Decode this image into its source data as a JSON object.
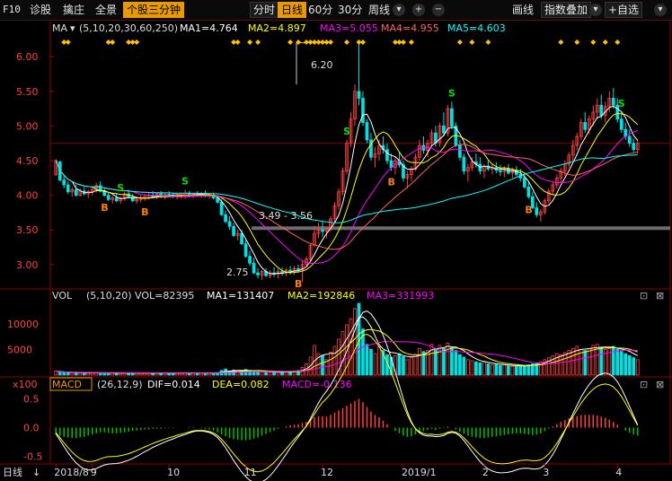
{
  "toolbar": {
    "f10": "F10",
    "diagnose": "诊股",
    "pullup": "擒庄",
    "overview": "全景",
    "period_3min": "个股三分钟",
    "intraday": "分时",
    "daily": "日线",
    "min60": "60分",
    "min30": "30分",
    "weekly": "周线",
    "draw": "画线",
    "overlay": "指数叠加",
    "add": "+",
    "watchlist": "+自选",
    "plus_icon": "+",
    "minus_icon": "−",
    "dropdown_icon": "▾"
  },
  "main_legend": {
    "name": "MA",
    "params": "(5,10,20,30,60,250)",
    "ma1": "MA1=4.764",
    "ma2": "MA2=4.897",
    "ma3": "MA3=5.055",
    "ma4": "MA4=4.955",
    "ma5": "MA5=4.603"
  },
  "annotations": {
    "high": "6.20",
    "low": "2.75",
    "range": "3.49 - 3.56"
  },
  "vol_legend": {
    "name": "VOL",
    "params": "(5,10,20)",
    "vol": "VOL=82395",
    "ma1": "MA1=131407",
    "ma2": "MA2=192846",
    "ma3": "MA3=331993",
    "unit": "x100"
  },
  "macd_legend": {
    "name": "MACD",
    "params": "(26,12,9)",
    "dif": "DIF=0.014",
    "dea": "DEA=0.082",
    "macd": "MACD=-0.136"
  },
  "bottom": {
    "period": "日线"
  },
  "colors": {
    "up": "#ff4040",
    "down": "#00e0e0",
    "ma1": "#ffffff",
    "ma2": "#ffff00",
    "ma3": "#ff00ff",
    "ma4": "#ff6060",
    "ma5": "#00ffff",
    "axis": "#b00000",
    "orange": "#ff8000"
  },
  "chart_data": {
    "type": "candlestick",
    "price_axis": {
      "ticks": [
        6.0,
        5.5,
        5.0,
        4.5,
        4.0,
        3.5,
        3.0
      ],
      "labels": [
        "6.00",
        "5.50",
        "5.00",
        "4.50",
        "4.00",
        "3.50",
        "3.00"
      ],
      "ylim": [
        2.7,
        6.3
      ]
    },
    "volume_axis": {
      "ticks": [
        10000,
        5000
      ],
      "labels": [
        "10000",
        "5000"
      ],
      "ylim": [
        0,
        14000
      ]
    },
    "macd_axis": {
      "ticks": [
        0.5,
        0.0,
        -0.5
      ],
      "labels": [
        "0.5",
        "0.0",
        "-0.5"
      ],
      "ylim": [
        -0.6,
        0.6
      ]
    },
    "x_labels": [
      "2018/8",
      "9",
      "10",
      "11",
      "12",
      "2019/1",
      "2",
      "3",
      "4"
    ],
    "signals": {
      "buy": "B",
      "sell": "S"
    },
    "candles": [
      [
        4.3,
        4.52,
        4.28,
        4.5
      ],
      [
        4.48,
        4.5,
        4.2,
        4.22
      ],
      [
        4.22,
        4.3,
        4.1,
        4.15
      ],
      [
        4.15,
        4.2,
        4.02,
        4.05
      ],
      [
        4.05,
        4.12,
        3.98,
        4.08
      ],
      [
        4.08,
        4.15,
        3.98,
        4.0
      ],
      [
        4.0,
        4.1,
        3.98,
        4.06
      ],
      [
        4.06,
        4.12,
        4.0,
        4.02
      ],
      [
        4.02,
        4.08,
        3.96,
        4.05
      ],
      [
        4.05,
        4.12,
        4.0,
        4.08
      ],
      [
        4.08,
        4.18,
        4.04,
        4.14
      ],
      [
        4.14,
        4.2,
        4.04,
        4.06
      ],
      [
        4.06,
        4.1,
        3.98,
        4.0
      ],
      [
        4.0,
        4.04,
        3.92,
        3.94
      ],
      [
        3.94,
        4.0,
        3.88,
        3.96
      ],
      [
        3.96,
        4.02,
        3.9,
        3.92
      ],
      [
        3.92,
        3.98,
        3.88,
        3.95
      ],
      [
        3.95,
        4.05,
        3.92,
        4.02
      ],
      [
        4.02,
        4.08,
        3.96,
        3.98
      ],
      [
        3.98,
        4.02,
        3.9,
        3.92
      ],
      [
        3.92,
        3.98,
        3.88,
        3.94
      ],
      [
        3.94,
        4.0,
        3.9,
        3.96
      ],
      [
        3.96,
        4.02,
        3.92,
        3.98
      ],
      [
        3.98,
        4.05,
        3.94,
        4.0
      ],
      [
        4.0,
        4.06,
        3.96,
        3.97
      ],
      [
        3.97,
        4.04,
        3.94,
        4.02
      ],
      [
        4.02,
        4.06,
        3.96,
        3.99
      ],
      [
        3.99,
        4.04,
        3.94,
        4.01
      ],
      [
        4.01,
        4.06,
        3.98,
        4.0
      ],
      [
        4.0,
        4.04,
        3.96,
        3.98
      ],
      [
        3.98,
        4.02,
        3.94,
        3.99
      ],
      [
        3.99,
        4.03,
        3.95,
        4.0
      ],
      [
        4.0,
        4.08,
        3.95,
        4.03
      ],
      [
        4.03,
        4.06,
        3.97,
        3.99
      ],
      [
        3.99,
        4.04,
        3.96,
        4.02
      ],
      [
        4.02,
        4.06,
        3.98,
        4.0
      ],
      [
        4.0,
        4.05,
        3.96,
        4.03
      ],
      [
        4.03,
        4.07,
        3.97,
        3.99
      ],
      [
        3.99,
        4.03,
        3.95,
        4.0
      ],
      [
        4.0,
        4.04,
        3.94,
        3.96
      ],
      [
        3.96,
        4.0,
        3.88,
        3.9
      ],
      [
        3.9,
        3.94,
        3.7,
        3.72
      ],
      [
        3.72,
        3.78,
        3.6,
        3.62
      ],
      [
        3.62,
        3.7,
        3.5,
        3.55
      ],
      [
        3.55,
        3.6,
        3.4,
        3.42
      ],
      [
        3.42,
        3.5,
        3.35,
        3.45
      ],
      [
        3.45,
        3.5,
        3.28,
        3.3
      ],
      [
        3.3,
        3.35,
        3.1,
        3.12
      ],
      [
        3.12,
        3.2,
        2.98,
        3.02
      ],
      [
        3.02,
        3.1,
        2.86,
        2.88
      ],
      [
        2.88,
        2.95,
        2.8,
        2.85
      ],
      [
        2.85,
        2.92,
        2.78,
        2.9
      ],
      [
        2.9,
        2.95,
        2.82,
        2.84
      ],
      [
        2.84,
        2.92,
        2.8,
        2.88
      ],
      [
        2.88,
        2.96,
        2.82,
        2.86
      ],
      [
        2.86,
        2.94,
        2.8,
        2.9
      ],
      [
        2.9,
        2.96,
        2.84,
        2.88
      ],
      [
        2.88,
        2.95,
        2.83,
        2.92
      ],
      [
        2.92,
        2.98,
        2.86,
        2.9
      ],
      [
        2.9,
        2.98,
        2.85,
        2.94
      ],
      [
        2.94,
        3.0,
        2.88,
        2.92
      ],
      [
        2.92,
        3.05,
        2.75,
        3.0
      ],
      [
        3.0,
        3.12,
        2.96,
        3.08
      ],
      [
        3.08,
        3.3,
        3.05,
        3.28
      ],
      [
        3.28,
        3.56,
        3.25,
        3.45
      ],
      [
        3.45,
        3.6,
        3.38,
        3.5
      ],
      [
        3.5,
        3.62,
        3.4,
        3.48
      ],
      [
        3.48,
        3.55,
        3.38,
        3.52
      ],
      [
        3.52,
        3.7,
        3.48,
        3.66
      ],
      [
        3.66,
        3.9,
        3.6,
        3.85
      ],
      [
        3.85,
        4.1,
        3.8,
        4.05
      ],
      [
        4.05,
        4.4,
        4.0,
        4.35
      ],
      [
        4.35,
        4.8,
        4.3,
        4.75
      ],
      [
        4.75,
        5.2,
        4.7,
        5.1
      ],
      [
        5.1,
        5.6,
        5.0,
        5.5
      ],
      [
        5.5,
        6.2,
        5.3,
        5.4
      ],
      [
        5.4,
        5.5,
        5.0,
        5.05
      ],
      [
        5.05,
        5.1,
        4.75,
        4.8
      ],
      [
        4.8,
        4.9,
        4.5,
        4.55
      ],
      [
        4.55,
        4.7,
        4.4,
        4.6
      ],
      [
        4.6,
        4.8,
        4.5,
        4.72
      ],
      [
        4.72,
        4.85,
        4.6,
        4.66
      ],
      [
        4.66,
        4.75,
        4.45,
        4.5
      ],
      [
        4.5,
        4.6,
        4.35,
        4.4
      ],
      [
        4.4,
        4.55,
        4.3,
        4.5
      ],
      [
        4.5,
        4.62,
        4.4,
        4.44
      ],
      [
        4.44,
        4.5,
        4.2,
        4.25
      ],
      [
        4.25,
        4.35,
        4.1,
        4.3
      ],
      [
        4.3,
        4.42,
        4.2,
        4.38
      ],
      [
        4.38,
        4.6,
        4.35,
        4.55
      ],
      [
        4.55,
        4.8,
        4.5,
        4.72
      ],
      [
        4.72,
        4.85,
        4.6,
        4.65
      ],
      [
        4.65,
        4.8,
        4.55,
        4.75
      ],
      [
        4.75,
        4.95,
        4.7,
        4.9
      ],
      [
        4.9,
        5.0,
        4.7,
        4.76
      ],
      [
        4.76,
        5.05,
        4.7,
        5.0
      ],
      [
        5.0,
        5.2,
        4.85,
        4.9
      ],
      [
        4.9,
        5.3,
        4.85,
        5.25
      ],
      [
        5.25,
        5.35,
        4.95,
        5.0
      ],
      [
        5.0,
        5.05,
        4.7,
        4.72
      ],
      [
        4.72,
        4.8,
        4.5,
        4.55
      ],
      [
        4.55,
        4.6,
        4.3,
        4.35
      ],
      [
        4.35,
        4.45,
        4.2,
        4.4
      ],
      [
        4.4,
        4.55,
        4.35,
        4.48
      ],
      [
        4.48,
        4.6,
        4.4,
        4.45
      ],
      [
        4.45,
        4.55,
        4.3,
        4.35
      ],
      [
        4.35,
        4.45,
        4.25,
        4.42
      ],
      [
        4.42,
        4.5,
        4.35,
        4.38
      ],
      [
        4.38,
        4.46,
        4.3,
        4.4
      ],
      [
        4.4,
        4.48,
        4.32,
        4.36
      ],
      [
        4.36,
        4.44,
        4.28,
        4.34
      ],
      [
        4.34,
        4.42,
        4.26,
        4.38
      ],
      [
        4.38,
        4.45,
        4.3,
        4.32
      ],
      [
        4.32,
        4.4,
        4.25,
        4.36
      ],
      [
        4.36,
        4.42,
        4.28,
        4.3
      ],
      [
        4.3,
        4.38,
        4.2,
        4.25
      ],
      [
        4.25,
        4.32,
        4.1,
        4.12
      ],
      [
        4.12,
        4.2,
        3.95,
        3.98
      ],
      [
        3.98,
        4.05,
        3.8,
        3.82
      ],
      [
        3.82,
        3.9,
        3.68,
        3.72
      ],
      [
        3.72,
        3.8,
        3.62,
        3.76
      ],
      [
        3.76,
        3.95,
        3.72,
        3.92
      ],
      [
        3.92,
        4.1,
        3.88,
        4.06
      ],
      [
        4.06,
        4.2,
        4.0,
        4.15
      ],
      [
        4.15,
        4.3,
        4.1,
        4.25
      ],
      [
        4.25,
        4.4,
        4.18,
        4.35
      ],
      [
        4.35,
        4.5,
        4.28,
        4.45
      ],
      [
        4.45,
        4.62,
        4.4,
        4.58
      ],
      [
        4.58,
        4.8,
        4.5,
        4.72
      ],
      [
        4.72,
        4.9,
        4.65,
        4.85
      ],
      [
        4.85,
        5.1,
        4.8,
        5.05
      ],
      [
        5.05,
        5.2,
        4.9,
        4.95
      ],
      [
        4.95,
        5.15,
        4.88,
        5.1
      ],
      [
        5.1,
        5.3,
        5.0,
        5.2
      ],
      [
        5.2,
        5.4,
        5.1,
        5.3
      ],
      [
        5.3,
        5.45,
        5.1,
        5.15
      ],
      [
        5.15,
        5.35,
        5.05,
        5.28
      ],
      [
        5.28,
        5.5,
        5.2,
        5.4
      ],
      [
        5.4,
        5.55,
        5.25,
        5.3
      ],
      [
        5.3,
        5.4,
        5.05,
        5.1
      ],
      [
        5.1,
        5.2,
        4.9,
        4.95
      ],
      [
        4.95,
        5.05,
        4.8,
        4.85
      ],
      [
        4.85,
        4.95,
        4.7,
        4.75
      ],
      [
        4.75,
        4.82,
        4.62,
        4.66
      ],
      [
        4.66,
        4.8,
        4.6,
        4.75
      ]
    ],
    "volume": [
      800,
      600,
      500,
      450,
      480,
      420,
      400,
      430,
      410,
      460,
      500,
      440,
      420,
      380,
      400,
      390,
      410,
      450,
      420,
      400,
      380,
      390,
      410,
      430,
      400,
      420,
      410,
      400,
      430,
      390,
      400,
      410,
      450,
      420,
      410,
      400,
      430,
      410,
      400,
      420,
      500,
      900,
      1200,
      800,
      1000,
      700,
      900,
      1100,
      800,
      900,
      700,
      600,
      650,
      500,
      600,
      550,
      700,
      600,
      650,
      800,
      900,
      1500,
      2200,
      3500,
      5800,
      4200,
      3800,
      3000,
      4500,
      5600,
      7000,
      8500,
      9800,
      11000,
      13000,
      14000,
      9000,
      6000,
      5000,
      4200,
      5500,
      4800,
      4000,
      3500,
      3800,
      4200,
      3600,
      3000,
      3400,
      4000,
      5200,
      4600,
      4800,
      6000,
      5000,
      5800,
      5200,
      6200,
      5400,
      4800,
      4000,
      3500,
      3000,
      2800,
      2600,
      2400,
      2500,
      2200,
      2000,
      2100,
      1900,
      2000,
      1800,
      1700,
      1800,
      1700,
      1900,
      2000,
      2200,
      2400,
      2600,
      3000,
      3400,
      3800,
      4200,
      4000,
      4400,
      4800,
      5200,
      5600,
      5000,
      4800,
      5200,
      5800,
      6000,
      5400,
      5000,
      5200,
      5600,
      5000,
      4600,
      4200,
      3800,
      3400,
      3000
    ],
    "macd_hist": [
      -0.12,
      -0.14,
      -0.16,
      -0.17,
      -0.18,
      -0.18,
      -0.17,
      -0.16,
      -0.14,
      -0.12,
      -0.1,
      -0.08,
      -0.08,
      -0.09,
      -0.1,
      -0.1,
      -0.09,
      -0.08,
      -0.07,
      -0.06,
      -0.05,
      -0.04,
      -0.03,
      -0.03,
      -0.02,
      -0.02,
      -0.02,
      -0.01,
      -0.01,
      -0.01,
      0.0,
      0.0,
      0.0,
      0.01,
      0.01,
      0.0,
      -0.01,
      -0.02,
      -0.03,
      -0.05,
      -0.08,
      -0.12,
      -0.15,
      -0.18,
      -0.2,
      -0.21,
      -0.22,
      -0.22,
      -0.21,
      -0.19,
      -0.17,
      -0.14,
      -0.11,
      -0.08,
      -0.05,
      -0.02,
      0.0,
      0.02,
      0.04,
      0.05,
      0.06,
      0.08,
      0.1,
      0.14,
      0.18,
      0.2,
      0.2,
      0.19,
      0.22,
      0.26,
      0.3,
      0.34,
      0.38,
      0.42,
      0.46,
      0.5,
      0.44,
      0.36,
      0.28,
      0.22,
      0.18,
      0.12,
      0.06,
      0.0,
      -0.06,
      -0.1,
      -0.14,
      -0.16,
      -0.15,
      -0.12,
      -0.08,
      -0.06,
      -0.04,
      -0.02,
      -0.04,
      -0.02,
      -0.01,
      0.02,
      0.0,
      -0.03,
      -0.07,
      -0.11,
      -0.14,
      -0.16,
      -0.17,
      -0.18,
      -0.18,
      -0.17,
      -0.16,
      -0.15,
      -0.14,
      -0.13,
      -0.12,
      -0.11,
      -0.1,
      -0.1,
      -0.11,
      -0.12,
      -0.13,
      -0.12,
      -0.1,
      -0.06,
      -0.02,
      0.02,
      0.06,
      0.1,
      0.13,
      0.16,
      0.18,
      0.2,
      0.22,
      0.22,
      0.22,
      0.22,
      0.21,
      0.19,
      0.17,
      0.14,
      0.1,
      0.05,
      0.0,
      -0.05,
      -0.09,
      -0.12,
      -0.14
    ],
    "legend_values": {
      "MA1": 4.764,
      "MA2": 4.897,
      "MA3": 5.055,
      "MA4": 4.955,
      "MA5": 4.603,
      "VOL": 82395,
      "VOL_MA1": 131407,
      "VOL_MA2": 192846,
      "VOL_MA3": 331993,
      "DIF": 0.014,
      "DEA": 0.082,
      "MACD": -0.136
    }
  }
}
